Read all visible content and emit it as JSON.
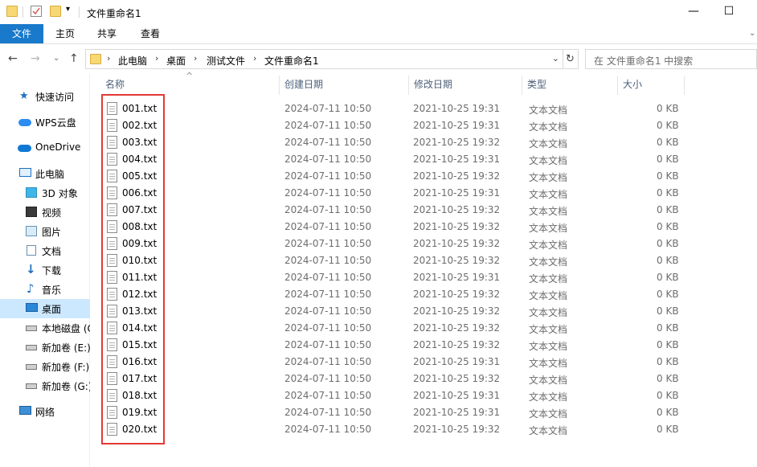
{
  "window": {
    "title": "文件重命名1",
    "minimize_glyph": "—",
    "maximize_glyph": "☐"
  },
  "ribbon": {
    "tabs": [
      "文件",
      "主页",
      "共享",
      "查看"
    ]
  },
  "address": {
    "crumbs": [
      "此电脑",
      "桌面",
      "测试文件",
      "文件重命名1"
    ],
    "search_placeholder": "在 文件重命名1 中搜索"
  },
  "sidebar": {
    "items": [
      {
        "label": "快速访问",
        "icon": "star-icon"
      },
      {
        "label": "WPS云盘",
        "icon": "cloud-icon"
      },
      {
        "label": "OneDrive",
        "icon": "onedrive-cloud-icon"
      },
      {
        "label": "此电脑",
        "icon": "computer-icon"
      },
      {
        "label": "3D 对象",
        "icon": "3d-objects-icon"
      },
      {
        "label": "视频",
        "icon": "video-icon"
      },
      {
        "label": "图片",
        "icon": "pictures-icon"
      },
      {
        "label": "文档",
        "icon": "documents-icon"
      },
      {
        "label": "下载",
        "icon": "download-icon"
      },
      {
        "label": "音乐",
        "icon": "music-icon"
      },
      {
        "label": "桌面",
        "icon": "desktop-icon"
      },
      {
        "label": "本地磁盘 (C:)",
        "icon": "drive-icon"
      },
      {
        "label": "新加卷 (E:)",
        "icon": "drive-icon"
      },
      {
        "label": "新加卷 (F:)",
        "icon": "drive-icon"
      },
      {
        "label": "新加卷 (G:)",
        "icon": "drive-icon"
      },
      {
        "label": "网络",
        "icon": "network-icon"
      }
    ],
    "selected": "桌面"
  },
  "columns": [
    "名称",
    "创建日期",
    "修改日期",
    "类型",
    "大小"
  ],
  "files": [
    {
      "name": "001.txt",
      "created": "2024-07-11 10:50",
      "modified": "2021-10-25 19:31",
      "type": "文本文档",
      "size": "0 KB"
    },
    {
      "name": "002.txt",
      "created": "2024-07-11 10:50",
      "modified": "2021-10-25 19:31",
      "type": "文本文档",
      "size": "0 KB"
    },
    {
      "name": "003.txt",
      "created": "2024-07-11 10:50",
      "modified": "2021-10-25 19:32",
      "type": "文本文档",
      "size": "0 KB"
    },
    {
      "name": "004.txt",
      "created": "2024-07-11 10:50",
      "modified": "2021-10-25 19:31",
      "type": "文本文档",
      "size": "0 KB"
    },
    {
      "name": "005.txt",
      "created": "2024-07-11 10:50",
      "modified": "2021-10-25 19:32",
      "type": "文本文档",
      "size": "0 KB"
    },
    {
      "name": "006.txt",
      "created": "2024-07-11 10:50",
      "modified": "2021-10-25 19:31",
      "type": "文本文档",
      "size": "0 KB"
    },
    {
      "name": "007.txt",
      "created": "2024-07-11 10:50",
      "modified": "2021-10-25 19:32",
      "type": "文本文档",
      "size": "0 KB"
    },
    {
      "name": "008.txt",
      "created": "2024-07-11 10:50",
      "modified": "2021-10-25 19:32",
      "type": "文本文档",
      "size": "0 KB"
    },
    {
      "name": "009.txt",
      "created": "2024-07-11 10:50",
      "modified": "2021-10-25 19:32",
      "type": "文本文档",
      "size": "0 KB"
    },
    {
      "name": "010.txt",
      "created": "2024-07-11 10:50",
      "modified": "2021-10-25 19:32",
      "type": "文本文档",
      "size": "0 KB"
    },
    {
      "name": "011.txt",
      "created": "2024-07-11 10:50",
      "modified": "2021-10-25 19:31",
      "type": "文本文档",
      "size": "0 KB"
    },
    {
      "name": "012.txt",
      "created": "2024-07-11 10:50",
      "modified": "2021-10-25 19:32",
      "type": "文本文档",
      "size": "0 KB"
    },
    {
      "name": "013.txt",
      "created": "2024-07-11 10:50",
      "modified": "2021-10-25 19:32",
      "type": "文本文档",
      "size": "0 KB"
    },
    {
      "name": "014.txt",
      "created": "2024-07-11 10:50",
      "modified": "2021-10-25 19:32",
      "type": "文本文档",
      "size": "0 KB"
    },
    {
      "name": "015.txt",
      "created": "2024-07-11 10:50",
      "modified": "2021-10-25 19:32",
      "type": "文本文档",
      "size": "0 KB"
    },
    {
      "name": "016.txt",
      "created": "2024-07-11 10:50",
      "modified": "2021-10-25 19:31",
      "type": "文本文档",
      "size": "0 KB"
    },
    {
      "name": "017.txt",
      "created": "2024-07-11 10:50",
      "modified": "2021-10-25 19:32",
      "type": "文本文档",
      "size": "0 KB"
    },
    {
      "name": "018.txt",
      "created": "2024-07-11 10:50",
      "modified": "2021-10-25 19:31",
      "type": "文本文档",
      "size": "0 KB"
    },
    {
      "name": "019.txt",
      "created": "2024-07-11 10:50",
      "modified": "2021-10-25 19:31",
      "type": "文本文档",
      "size": "0 KB"
    },
    {
      "name": "020.txt",
      "created": "2024-07-11 10:50",
      "modified": "2021-10-25 19:32",
      "type": "文本文档",
      "size": "0 KB"
    }
  ],
  "colors": {
    "accent": "#1979ca",
    "selection": "#cce8ff",
    "highlight_box": "#e53935"
  }
}
